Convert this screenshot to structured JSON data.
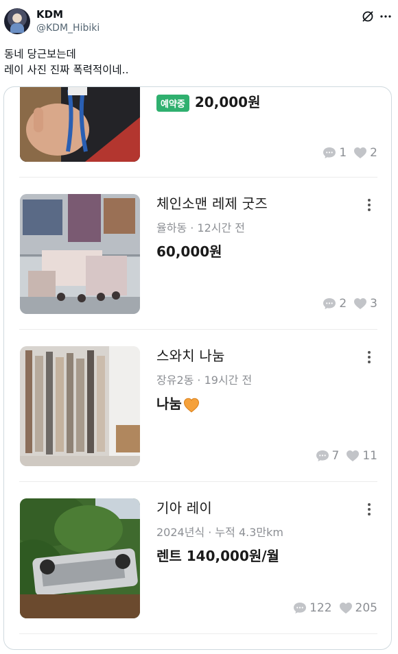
{
  "tweet": {
    "author_name": "KDM",
    "author_handle": "@KDM_Hibiki",
    "text_line1": "동네 당근보는데",
    "text_line2": "레이 사진 진짜 폭력적이네.."
  },
  "listings": [
    {
      "badge": "예약중",
      "price": "20,000원",
      "chats": "1",
      "likes": "2"
    },
    {
      "title": "체인소맨 레제 굿즈",
      "meta": "율하동 · 12시간 전",
      "price": "60,000원",
      "chats": "2",
      "likes": "3"
    },
    {
      "title": "스와치 나눔",
      "meta": "장유2동 · 19시간 전",
      "price": "나눔",
      "chats": "7",
      "likes": "11"
    },
    {
      "title": "기아 레이",
      "meta": "2024년식 · 누적 4.3만km",
      "price": "렌트 140,000원/월",
      "chats": "122",
      "likes": "205"
    }
  ],
  "colors": {
    "badge": "#2fb06f",
    "muted": "#8c8f94",
    "heart_emoji": "#f5a13b"
  }
}
